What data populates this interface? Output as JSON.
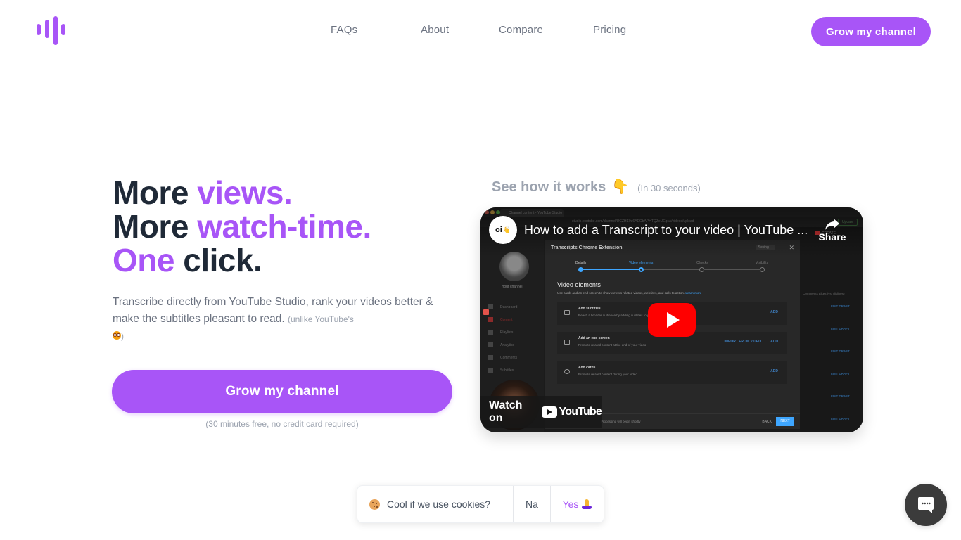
{
  "brand": {
    "accent": "#a855f7",
    "logo_icon": "sound-wave-icon"
  },
  "nav": {
    "items": [
      {
        "label": "FAQs"
      },
      {
        "label": "About"
      },
      {
        "label": "Compare"
      },
      {
        "label": "Pricing"
      }
    ],
    "cta_label": "Grow my channel"
  },
  "hero": {
    "title": {
      "line1_plain": "More",
      "line1_accent": "views.",
      "line2_plain": "More",
      "line2_accent": "watch-time.",
      "line3_accent": "One",
      "line3_plain": "click."
    },
    "description": "Transcribe directly from YouTube Studio, rank your videos better & make the subtitles pleasant to read.",
    "description_aside_open": "(unlike YouTube's",
    "description_aside_close": ")",
    "description_emoji": "flushed-face",
    "cta_label": "Grow my channel",
    "cta_note": "(30 minutes free, no credit card required)"
  },
  "video_section": {
    "heading": "See how it works",
    "heading_emoji": "👇",
    "heading_sub": "(In 30 seconds)",
    "video": {
      "title": "How to add a Transcript to your video | YouTube ...",
      "channel_avatar_text": "oi",
      "channel_avatar_emoji": "👋",
      "share_label": "Share",
      "watch_on_label": "Watch on",
      "youtube_label": "YouTube",
      "thumbnail": {
        "browser_tab": "Channel content - YouTube Studio",
        "url": "studio.youtube.com/channel/UCZHE0u6AEObAPHTQZeUEgsA/videos/upload",
        "update_label": "Update",
        "create_label": "CREATE",
        "your_channel": "Your channel",
        "sidebar_items": [
          "Dashboard",
          "Content",
          "Playlists",
          "Analytics",
          "Comments",
          "Subtitles"
        ],
        "dialog_title": "Transcripts Chrome Extension",
        "saving_label": "Saving...",
        "steps": [
          "Details",
          "Video elements",
          "Checks",
          "Visibility"
        ],
        "section_title": "Video elements",
        "section_desc": "Use cards and an end screen to show viewers related videos, websites, and calls to action.",
        "learn_more": "Learn more",
        "rows": [
          {
            "name": "Add subtitles",
            "sub": "Reach a broader audience by adding subtitles to your video",
            "action": "ADD"
          },
          {
            "name": "Add an end screen",
            "sub": "Promote related content at the end of your video",
            "action": "ADD",
            "secondary_action": "IMPORT FROM VIDEO"
          },
          {
            "name": "Add cards",
            "sub": "Promote related content during your video",
            "action": "ADD"
          }
        ],
        "processing_text": "Processing will begin shortly",
        "back_label": "BACK",
        "next_label": "NEXT",
        "table_headers": "Comments   Likes (vs. dislikes)",
        "edit_draft_label": "EDIT DRAFT"
      }
    }
  },
  "cookie_banner": {
    "emoji": "cookie",
    "message": "Cool if we use cookies?",
    "decline_label": "Na",
    "accept_label": "Yes",
    "accept_emoji": "folded-hands"
  },
  "chat_widget": {
    "icon": "chat-bubble-icon"
  }
}
